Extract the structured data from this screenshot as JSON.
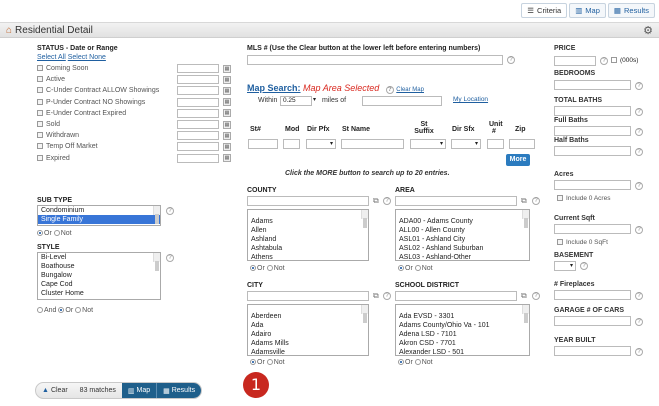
{
  "view_buttons": {
    "criteria": "Criteria",
    "map": "Map",
    "results": "Results"
  },
  "title": "Residential Detail",
  "status": {
    "label": "STATUS - Date or Range",
    "select_all": "Select All",
    "select_none": "Select None",
    "items": [
      "Coming Soon",
      "Active",
      "C-Under Contract ALLOW Showings",
      "P-Under Contract NO Showings",
      "E-Under Contract Expired",
      "Sold",
      "Withdrawn",
      "Temp Off Market",
      "Expired"
    ]
  },
  "sub_type": {
    "label": "SUB TYPE",
    "options": [
      "Condominium",
      "Single Family"
    ],
    "selected": "Single Family",
    "or": "Or",
    "not": "Not"
  },
  "style": {
    "label": "STYLE",
    "options": [
      "Bi-Level",
      "Boathouse",
      "Bungalow",
      "Cape Cod",
      "Cluster Home"
    ],
    "and": "And",
    "or": "Or",
    "not": "Not"
  },
  "mls": {
    "label": "MLS # (Use the Clear button at the lower left before entering numbers)"
  },
  "map_search": {
    "label": "Map Search:",
    "status": "Map Area Selected",
    "clear_map": "Clear Map",
    "within": "Within",
    "within_value": "0.25",
    "miles_of": "miles of",
    "my_location": "My Location"
  },
  "address": {
    "cols": [
      "St#",
      "Mod",
      "Dir Pfx",
      "St Name",
      "St Suffix",
      "Dir Sfx",
      "Unit #",
      "Zip"
    ],
    "more": "More",
    "hint": "Click the MORE button to search up to 20 entries."
  },
  "county": {
    "label": "COUNTY",
    "options": [
      "Adams",
      "Allen",
      "Ashland",
      "Ashtabula",
      "Athens"
    ],
    "or": "Or",
    "not": "Not"
  },
  "area": {
    "label": "AREA",
    "options": [
      "ADA00 - Adams County",
      "ALL00 - Allen County",
      "ASL01 - Ashland City",
      "ASL02 - Ashland Suburban",
      "ASL03 - Ashland-Other"
    ],
    "or": "Or",
    "not": "Not"
  },
  "city": {
    "label": "CITY",
    "options": [
      "Aberdeen",
      "Ada",
      "Adairo",
      "Adams Mills",
      "Adamsville"
    ],
    "or": "Or",
    "not": "Not"
  },
  "school": {
    "label": "SCHOOL DISTRICT",
    "options": [
      "Ada EVSD - 3301",
      "Adams County/Ohio Va - 101",
      "Adena LSD - 7101",
      "Akron CSD - 7701",
      "Alexander LSD - 501"
    ],
    "or": "Or",
    "not": "Not"
  },
  "right": {
    "price": "PRICE",
    "price_unit": "(000s)",
    "bedrooms": "BEDROOMS",
    "total_baths": "TOTAL BATHS",
    "full_baths": "Full Baths",
    "half_baths": "Half Baths",
    "acres": "Acres",
    "include_acres": "Include 0 Acres",
    "current_sqft": "Current Sqft",
    "include_sqft": "Include 0 SqFt",
    "basement": "BASEMENT",
    "fireplaces": "# Fireplaces",
    "garage": "GARAGE # OF CARS",
    "year_built": "YEAR BUILT"
  },
  "footer": {
    "clear": "Clear",
    "matches": "83 matches",
    "map": "Map",
    "results": "Results"
  },
  "badge": "1"
}
